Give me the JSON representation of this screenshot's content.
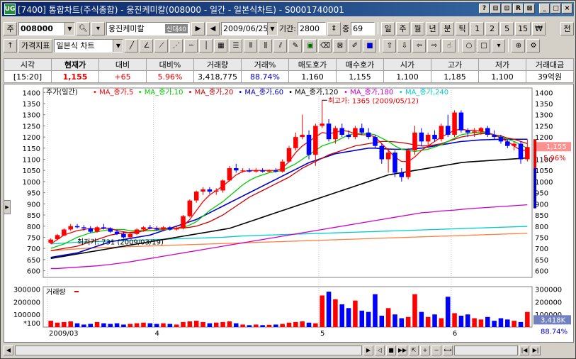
{
  "window": {
    "title": "[7400] 통합차트(주식종합) - 웅진케미칼(008000 - 일간 - 일본식차트) - S0001740001",
    "app_icon": "UG",
    "buttons": [
      "?",
      "⊟",
      "⊡",
      "R",
      "⊠",
      "_",
      "□",
      "×"
    ]
  },
  "toolbar1": {
    "code_prefix": "주",
    "code": "008000",
    "stock_name": "웅진케미칼",
    "credit_badge": "신대40",
    "date": "2009/06/25",
    "period_label": "기간:",
    "period_value": "2800",
    "center_label": "중",
    "center_value": "69",
    "intervals": [
      "일",
      "주",
      "월",
      "년",
      "분",
      "틱",
      "1",
      "2",
      "5",
      "15",
      "₩"
    ],
    "tail": "전"
  },
  "toolbar2": {
    "indicator_button": "가격지표",
    "chart_type": "일본식 차트"
  },
  "quote": {
    "headers": [
      "시각",
      "현재가",
      "대비",
      "대비%",
      "거래량",
      "거래%",
      "매도호가",
      "매수호가",
      "시가",
      "고가",
      "저가",
      "거래대금"
    ],
    "values": [
      "[15:20]",
      "1,155",
      "+65",
      "5.96%",
      "3,418,775",
      "88.74%",
      "1,160",
      "1,155",
      "1,100",
      "1,185",
      "1,100",
      "39억원"
    ]
  },
  "colors": {
    "up": "#ff0000",
    "down": "#0000ff",
    "ma5": "#ff0000",
    "ma10": "#00cc00",
    "ma20": "#cc0000",
    "ma60": "#0000cc",
    "ma120": "#000000",
    "ma180": "#cc00cc",
    "ma240": "#00cccc",
    "ma_orange": "#ff8040"
  },
  "chart_data": {
    "type": "candlestick",
    "legend_price": "주가(일간)",
    "legend_ma": [
      "MA_종가,5",
      "MA_종가,10",
      "MA_종가,20",
      "MA_종가,60",
      "MA_종가,120",
      "MA_종가,180",
      "MA_종가,240"
    ],
    "high_note": "최고가: 1365 (2009/05/12)",
    "low_note": "최저가: 731 (2009/03/19)",
    "price_ylim": [
      570,
      1420
    ],
    "price_ticks": [
      1400,
      1350,
      1300,
      1250,
      1200,
      1150,
      1100,
      1050,
      1000,
      950,
      900,
      850,
      800,
      750,
      700,
      650,
      600
    ],
    "price_tag": "1,155",
    "pct_tag": "5.96%",
    "volume_title": "거래량",
    "volume_ticks": [
      "300000",
      "200000",
      "100000"
    ],
    "volume_ticks_right": [
      "300000",
      "200000",
      "100000"
    ],
    "volume_unit": "*100",
    "volume_tag": "3,418K",
    "volume_pct": "88.74%",
    "x_labels": [
      "2009/03",
      "4",
      "5",
      "6"
    ],
    "candles": [
      [
        725,
        745,
        720,
        740
      ],
      [
        742,
        765,
        738,
        760
      ],
      [
        758,
        790,
        755,
        785
      ],
      [
        785,
        810,
        780,
        800
      ],
      [
        800,
        810,
        790,
        795
      ],
      [
        795,
        805,
        780,
        790
      ],
      [
        790,
        800,
        770,
        775
      ],
      [
        775,
        800,
        770,
        795
      ],
      [
        795,
        810,
        785,
        790
      ],
      [
        790,
        795,
        770,
        775
      ],
      [
        775,
        785,
        760,
        765
      ],
      [
        765,
        775,
        745,
        750
      ],
      [
        750,
        770,
        745,
        765
      ],
      [
        765,
        790,
        760,
        785
      ],
      [
        785,
        800,
        775,
        795
      ],
      [
        795,
        805,
        785,
        790
      ],
      [
        790,
        800,
        780,
        785
      ],
      [
        785,
        800,
        780,
        795
      ],
      [
        795,
        800,
        780,
        785
      ],
      [
        785,
        800,
        780,
        790
      ],
      [
        790,
        850,
        785,
        845
      ],
      [
        845,
        920,
        840,
        915
      ],
      [
        915,
        960,
        905,
        955
      ],
      [
        955,
        975,
        940,
        965
      ],
      [
        965,
        975,
        945,
        955
      ],
      [
        955,
        970,
        940,
        960
      ],
      [
        960,
        1010,
        950,
        1005
      ],
      [
        1005,
        1070,
        1000,
        1060
      ],
      [
        1060,
        1080,
        1040,
        1050
      ],
      [
        1050,
        1060,
        1040,
        1050
      ],
      [
        1050,
        1060,
        1040,
        1045
      ],
      [
        1045,
        1060,
        1040,
        1050
      ],
      [
        1050,
        1060,
        1040,
        1045
      ],
      [
        1045,
        1055,
        1040,
        1050
      ],
      [
        1050,
        1060,
        1040,
        1045
      ],
      [
        1045,
        1100,
        1040,
        1090
      ],
      [
        1090,
        1160,
        1085,
        1150
      ],
      [
        1150,
        1220,
        1140,
        1200
      ],
      [
        1200,
        1300,
        1190,
        1210
      ],
      [
        1210,
        1230,
        1100,
        1120
      ],
      [
        1120,
        1260,
        1070,
        1250
      ],
      [
        1250,
        1365,
        1240,
        1260
      ],
      [
        1260,
        1280,
        1180,
        1190
      ],
      [
        1190,
        1250,
        1170,
        1240
      ],
      [
        1240,
        1260,
        1200,
        1210
      ],
      [
        1210,
        1230,
        1190,
        1200
      ],
      [
        1200,
        1250,
        1190,
        1240
      ],
      [
        1240,
        1260,
        1210,
        1220
      ],
      [
        1220,
        1240,
        1190,
        1200
      ],
      [
        1200,
        1210,
        1150,
        1160
      ],
      [
        1160,
        1170,
        1080,
        1100
      ],
      [
        1100,
        1150,
        1040,
        1130
      ],
      [
        1130,
        1140,
        1020,
        1040
      ],
      [
        1040,
        1060,
        1000,
        1020
      ],
      [
        1020,
        1150,
        1010,
        1140
      ],
      [
        1140,
        1250,
        1120,
        1220
      ],
      [
        1220,
        1240,
        1160,
        1180
      ],
      [
        1180,
        1220,
        1150,
        1210
      ],
      [
        1210,
        1230,
        1180,
        1190
      ],
      [
        1190,
        1260,
        1180,
        1250
      ],
      [
        1250,
        1300,
        1200,
        1210
      ],
      [
        1210,
        1320,
        1200,
        1310
      ],
      [
        1310,
        1320,
        1220,
        1230
      ],
      [
        1230,
        1240,
        1200,
        1220
      ],
      [
        1220,
        1240,
        1200,
        1225
      ],
      [
        1225,
        1245,
        1210,
        1240
      ],
      [
        1240,
        1250,
        1200,
        1210
      ],
      [
        1210,
        1230,
        1190,
        1200
      ],
      [
        1200,
        1210,
        1170,
        1180
      ],
      [
        1180,
        1190,
        1150,
        1160
      ],
      [
        1160,
        1180,
        1140,
        1170
      ],
      [
        1170,
        1180,
        1080,
        1100
      ],
      [
        1100,
        1190,
        1090,
        1155
      ]
    ],
    "volumes": [
      500,
      350,
      400,
      450,
      300,
      200,
      250,
      400,
      300,
      250,
      300,
      200,
      250,
      300,
      350,
      300,
      250,
      300,
      250,
      200,
      400,
      450,
      500,
      400,
      300,
      350,
      400,
      450,
      300,
      200,
      150,
      200,
      150,
      180,
      200,
      250,
      350,
      400,
      450,
      350,
      300,
      2500,
      2800,
      2200,
      1800,
      1500,
      2100,
      1300,
      1200,
      2600,
      900,
      1500,
      1000,
      700,
      800,
      2600,
      1200,
      800,
      1000,
      700,
      2400,
      1100,
      900,
      1000,
      700,
      600,
      800,
      500,
      700,
      600,
      500,
      400,
      1200
    ],
    "ma_series": {
      "ma5": [
        720,
        740,
        760,
        770,
        780,
        785,
        790,
        785,
        790,
        790,
        780,
        775,
        770,
        770,
        780,
        790,
        790,
        790,
        790,
        790,
        800,
        830,
        870,
        910,
        940,
        960,
        980,
        1005,
        1030,
        1045,
        1050,
        1050,
        1050,
        1050,
        1050,
        1060,
        1090,
        1130,
        1160,
        1180,
        1200,
        1220,
        1215,
        1220,
        1230,
        1225,
        1215,
        1210,
        1210,
        1200,
        1170,
        1140,
        1110,
        1090,
        1090,
        1110,
        1140,
        1160,
        1180,
        1200,
        1215,
        1230,
        1235,
        1230,
        1230,
        1225,
        1220,
        1210,
        1195,
        1180,
        1160,
        1140,
        1140
      ],
      "ma10": [
        700,
        710,
        720,
        735,
        750,
        760,
        770,
        775,
        780,
        785,
        785,
        785,
        780,
        780,
        780,
        780,
        780,
        785,
        785,
        790,
        795,
        805,
        820,
        845,
        870,
        890,
        910,
        935,
        960,
        985,
        1005,
        1020,
        1030,
        1040,
        1045,
        1050,
        1065,
        1080,
        1100,
        1120,
        1140,
        1160,
        1170,
        1180,
        1195,
        1210,
        1215,
        1215,
        1215,
        1210,
        1195,
        1180,
        1160,
        1145,
        1140,
        1135,
        1140,
        1145,
        1155,
        1165,
        1180,
        1195,
        1210,
        1215,
        1220,
        1220,
        1215,
        1210,
        1200,
        1190,
        1180,
        1165,
        1150
      ],
      "ma20": [
        690,
        695,
        700,
        705,
        710,
        720,
        730,
        740,
        750,
        760,
        765,
        770,
        772,
        775,
        778,
        780,
        782,
        785,
        788,
        790,
        792,
        795,
        800,
        810,
        820,
        835,
        850,
        870,
        890,
        910,
        930,
        945,
        960,
        975,
        990,
        1005,
        1020,
        1040,
        1060,
        1075,
        1090,
        1105,
        1120,
        1130,
        1140,
        1150,
        1160,
        1165,
        1170,
        1175,
        1180,
        1180,
        1178,
        1175,
        1170,
        1165,
        1160,
        1160,
        1165,
        1170,
        1180,
        1190,
        1200,
        1205,
        1210,
        1215,
        1215,
        1210,
        1205,
        1195,
        1190,
        1180,
        1170
      ],
      "ma60": [
        660,
        665,
        670,
        675,
        680,
        690,
        700,
        710,
        720,
        730,
        735,
        740,
        745,
        750,
        755,
        760,
        770,
        780,
        790,
        800,
        810,
        820,
        830,
        845,
        860,
        875,
        890,
        905,
        920,
        935,
        950,
        965,
        980,
        995,
        1010,
        1025,
        1040,
        1055,
        1070,
        1085,
        1095,
        1105,
        1115,
        1125,
        1130,
        1135,
        1140,
        1145,
        1150,
        1150,
        1148,
        1146,
        1145,
        1145,
        1145,
        1148,
        1150,
        1155,
        1160,
        1165,
        1170,
        1175,
        1180,
        1182,
        1185,
        1187,
        1188,
        1189,
        1190,
        1190,
        1190,
        1190,
        1190
      ],
      "ma120": [
        655,
        660,
        665,
        670,
        675,
        680,
        685,
        690,
        695,
        700,
        705,
        710,
        715,
        720,
        725,
        730,
        735,
        740,
        745,
        750,
        755,
        760,
        765,
        770,
        775,
        780,
        785,
        790,
        800,
        810,
        820,
        830,
        840,
        850,
        860,
        870,
        880,
        890,
        900,
        910,
        920,
        930,
        940,
        950,
        960,
        970,
        980,
        990,
        1000,
        1010,
        1020,
        1030,
        1035,
        1040,
        1045,
        1050,
        1055,
        1060,
        1065,
        1070,
        1075,
        1080,
        1085,
        1088,
        1090,
        1092,
        1094,
        1096,
        1098,
        1100,
        1102,
        1104,
        1106
      ],
      "ma180": [
        610,
        610,
        612,
        614,
        616,
        618,
        620,
        622,
        625,
        628,
        632,
        636,
        640,
        645,
        650,
        655,
        660,
        665,
        670,
        675,
        680,
        685,
        690,
        695,
        700,
        705,
        710,
        715,
        720,
        725,
        730,
        735,
        740,
        745,
        750,
        755,
        760,
        765,
        770,
        775,
        780,
        785,
        790,
        795,
        800,
        805,
        810,
        815,
        820,
        825,
        830,
        835,
        840,
        845,
        850,
        855,
        860,
        862,
        865,
        868,
        870,
        872,
        875,
        878,
        880,
        882,
        884,
        886,
        888,
        890,
        892,
        894,
        896
      ],
      "ma240": [
        720,
        722,
        724,
        726,
        728,
        729,
        730,
        731,
        732,
        733,
        734,
        735,
        736,
        737,
        738,
        739,
        740,
        741,
        742,
        743,
        744,
        745,
        746,
        747,
        748,
        749,
        750,
        752,
        754,
        756,
        757,
        758,
        759,
        760,
        761,
        762,
        763,
        764,
        765,
        766,
        767,
        768,
        769,
        770,
        771,
        772,
        773,
        774,
        775,
        776,
        777,
        778,
        779,
        780,
        781,
        782,
        783,
        784,
        785,
        786,
        787,
        788,
        789,
        790,
        791,
        792,
        793,
        794,
        795,
        796,
        797,
        798,
        799
      ],
      "ma_orange": [
        690,
        692,
        694,
        696,
        698,
        700,
        702,
        703,
        704,
        705,
        706,
        707,
        708,
        709,
        710,
        711,
        712,
        713,
        714,
        715,
        716,
        717,
        718,
        719,
        720,
        721,
        722,
        723,
        724,
        725,
        726,
        727,
        728,
        729,
        730,
        731,
        732,
        733,
        734,
        735,
        736,
        737,
        738,
        739,
        740,
        741,
        742,
        743,
        744,
        745,
        746,
        747,
        748,
        749,
        750,
        751,
        752,
        753,
        754,
        755,
        756,
        757,
        758,
        759,
        760,
        761,
        762,
        763,
        764,
        765,
        766,
        767,
        768
      ]
    }
  }
}
